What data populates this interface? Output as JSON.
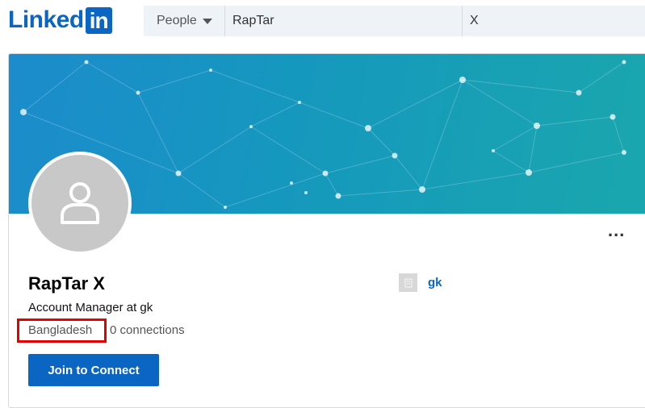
{
  "header": {
    "logo_text": "Linked",
    "logo_box_text": "in",
    "search": {
      "type_label": "People",
      "first_name": "RapTar",
      "last_name": "X"
    }
  },
  "profile": {
    "name": "RapTar X",
    "headline": "Account Manager at gk",
    "location": "Bangladesh",
    "connections": "0 connections",
    "join_button": "Join to Connect",
    "more_label": "...",
    "company": {
      "name": "gk"
    }
  },
  "colors": {
    "brand": "#0a66c2",
    "banner_start": "#1c8ccc",
    "banner_end": "#1aa7ad",
    "highlight": "#e60000"
  }
}
